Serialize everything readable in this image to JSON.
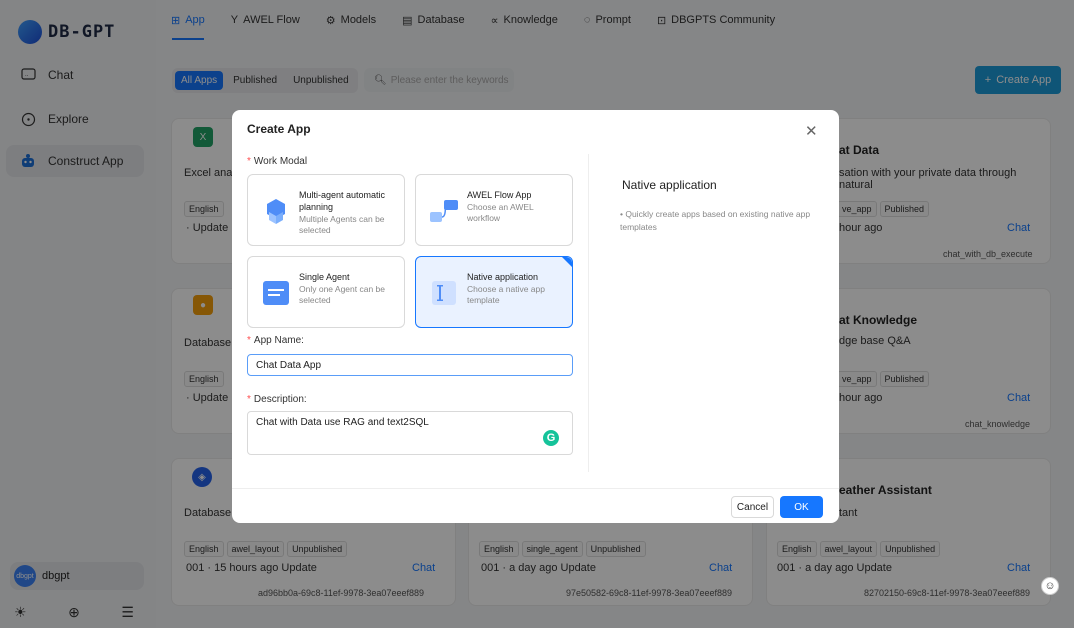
{
  "logo": {
    "text": "DB-GPT"
  },
  "sidebar": {
    "items": [
      {
        "label": "Chat",
        "icon": "chat-icon"
      },
      {
        "label": "Explore",
        "icon": "compass-icon"
      },
      {
        "label": "Construct App",
        "icon": "robot-icon"
      }
    ],
    "user": {
      "avatar": "dbgpt",
      "name": "dbgpt"
    }
  },
  "nav": {
    "tabs": [
      {
        "label": "App",
        "icon": "grid-icon"
      },
      {
        "label": "AWEL Flow",
        "icon": "flow-icon"
      },
      {
        "label": "Models",
        "icon": "models-icon"
      },
      {
        "label": "Database",
        "icon": "database-icon"
      },
      {
        "label": "Knowledge",
        "icon": "knowledge-icon"
      },
      {
        "label": "Prompt",
        "icon": "prompt-icon"
      },
      {
        "label": "DBGPTS Community",
        "icon": "community-icon"
      }
    ]
  },
  "filters": {
    "all": "All Apps",
    "published": "Published",
    "unpublished": "Unpublished"
  },
  "search": {
    "placeholder": "Please enter the keywords"
  },
  "create_button": "Create App",
  "cards": {
    "c1": {
      "desc": "Excel analy",
      "tag1": "English",
      "meta": "· Update"
    },
    "c2": {
      "desc": "Database M",
      "tag1": "English",
      "meta": "· Update"
    },
    "c3": {
      "desc": "Database E",
      "tags": [
        "English",
        "awel_layout",
        "Unpublished"
      ],
      "meta": "001 · 15 hours ago Update",
      "chat": "Chat",
      "id": "ad96bb0a-69c8-11ef-9978-3ea07eeef889"
    },
    "c4": {
      "tags": [
        "English",
        "single_agent",
        "Unpublished"
      ],
      "meta": "001 · a day ago Update",
      "chat": "Chat",
      "id": "97e50582-69c8-11ef-9978-3ea07eeef889"
    },
    "c5": {
      "title": "at Data",
      "desc": "sation with your private data through natural",
      "tags": [
        "ve_app",
        "Published"
      ],
      "meta": "hour ago",
      "chat": "Chat",
      "id": "chat_with_db_execute"
    },
    "c6": {
      "title": "at Knowledge",
      "desc": "dge base Q&A",
      "tags": [
        "ve_app",
        "Published"
      ],
      "meta": "hour ago",
      "chat": "Chat",
      "id": "chat_knowledge"
    },
    "c7": {
      "title": "eather Assistant",
      "desc": "tant",
      "tags": [
        "English",
        "awel_layout",
        "Unpublished"
      ],
      "meta": "001 · a day ago Update",
      "chat": "Chat",
      "id": "82702150-69c8-11ef-9978-3ea07eeef889"
    }
  },
  "modal": {
    "title": "Create App",
    "work_modal_label": "Work Modal",
    "options": [
      {
        "title": "Multi-agent automatic planning",
        "sub": "Multiple Agents can be selected"
      },
      {
        "title": "AWEL Flow App",
        "sub": "Choose an AWEL workflow"
      },
      {
        "title": "Single Agent",
        "sub": "Only one Agent can be selected"
      },
      {
        "title": "Native application",
        "sub": "Choose a native app template"
      }
    ],
    "right_title": "Native application",
    "right_desc": "• Quickly create apps based on existing native app templates",
    "app_name_label": "App Name:",
    "app_name_value": "Chat Data App",
    "desc_label": "Description:",
    "desc_value": "Chat with Data use RAG and text2SQL",
    "cancel": "Cancel",
    "ok": "OK"
  },
  "colors": {
    "accent": "#1677ff",
    "create": "#1c9bd9"
  }
}
